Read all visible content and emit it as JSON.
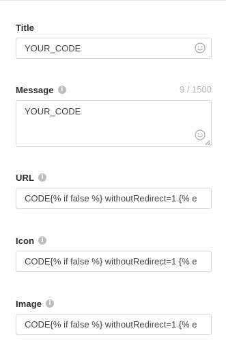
{
  "fields": {
    "title": {
      "label": "Title",
      "value": "YOUR_CODE"
    },
    "message": {
      "label": "Message",
      "value": "YOUR_CODE",
      "counter": "9 / 1500"
    },
    "url": {
      "label": "URL",
      "value": "CODE{% if false %} withoutRedirect=1 {% e"
    },
    "icon": {
      "label": "Icon",
      "value": "CODE{% if false %} withoutRedirect=1 {% e"
    },
    "image": {
      "label": "Image",
      "value": "CODE{% if false %} withoutRedirect=1 {% e"
    }
  },
  "icons": {
    "info": "i",
    "emoji": "smiley-emoji-icon"
  },
  "colors": {
    "label": "#2d2d2d",
    "border": "#d7d7d7",
    "muted": "#b4b4b4",
    "info_icon": "#bdbdbd",
    "text": "#444444"
  }
}
